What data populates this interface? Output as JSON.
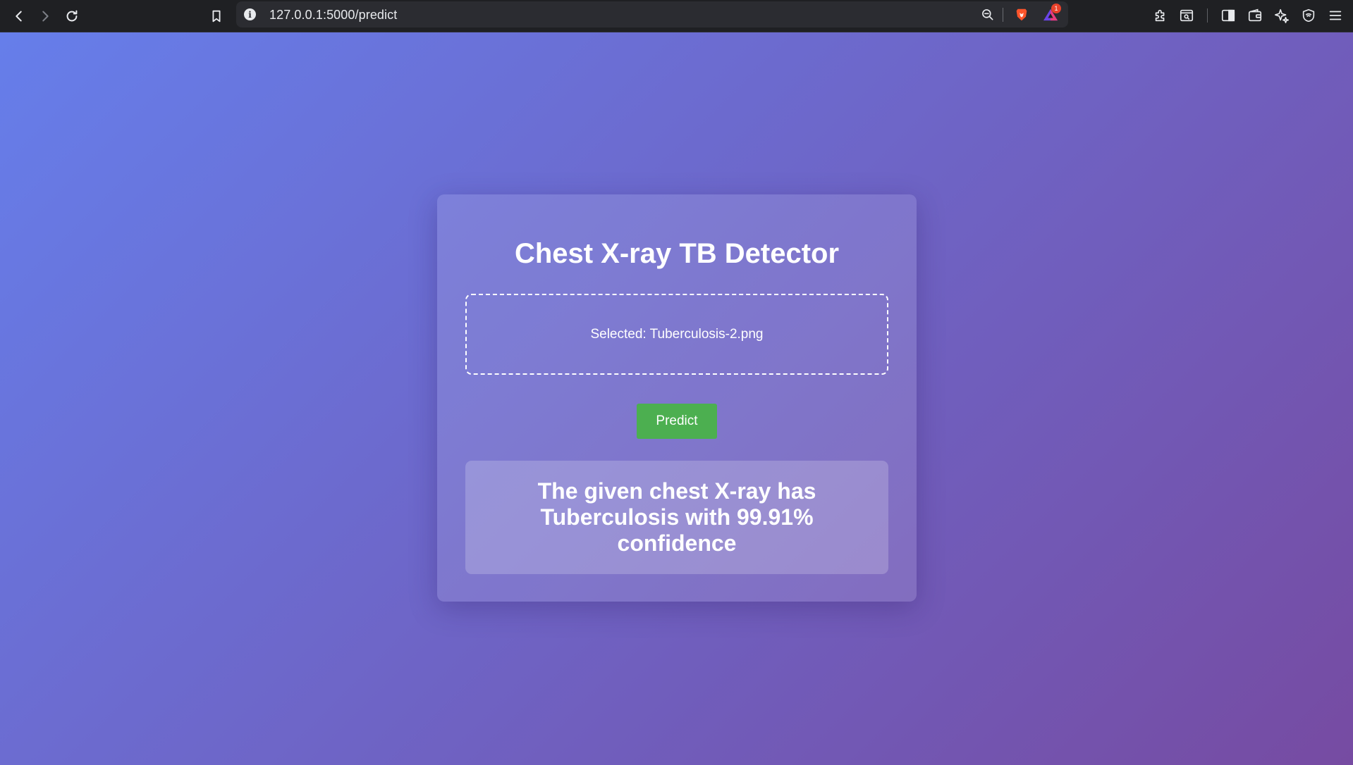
{
  "browser": {
    "url": "127.0.0.1:5000/predict",
    "notification_count": "1",
    "icons": {
      "back": "back-arrow-icon",
      "forward": "forward-arrow-icon",
      "reload": "reload-icon",
      "bookmark": "bookmark-icon",
      "site_info": "info-icon",
      "zoom": "zoom-out-icon",
      "brave_shields": "brave-lion-icon",
      "brave_rewards": "brave-rewards-triangle-icon",
      "extensions": "puzzle-icon",
      "page_search": "page-search-icon",
      "sidebar": "sidebar-icon",
      "wallet": "wallet-icon",
      "leo_ai": "sparkle-icon",
      "vpn": "shield-icon",
      "menu": "hamburger-menu-icon"
    }
  },
  "app": {
    "title": "Chest X-ray TB Detector",
    "selected_file": "Selected: Tuberculosis-2.png",
    "predict_label": "Predict",
    "result": "The given chest X-ray has Tuberculosis with 99.91% confidence"
  },
  "colors": {
    "gradient_start": "#667eea",
    "gradient_end": "#764ba2",
    "predict_button": "#4caf50",
    "chrome_bg": "#1f2023",
    "omnibox_bg": "#2b2c31"
  }
}
